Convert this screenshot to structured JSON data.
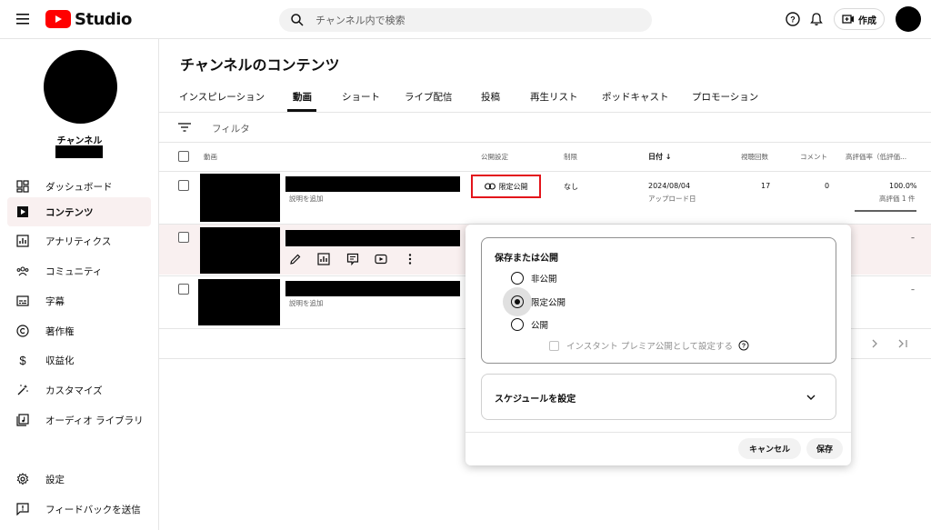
{
  "header": {
    "logo_text": "Studio",
    "search_placeholder": "チャンネル内で検索",
    "create_label": "作成"
  },
  "sidebar": {
    "channel_label": "チャンネル",
    "items": [
      {
        "label": "ダッシュボード",
        "icon": "dashboard-icon"
      },
      {
        "label": "コンテンツ",
        "icon": "content-icon",
        "active": true
      },
      {
        "label": "アナリティクス",
        "icon": "analytics-icon"
      },
      {
        "label": "コミュニティ",
        "icon": "community-icon"
      },
      {
        "label": "字幕",
        "icon": "subtitles-icon"
      },
      {
        "label": "著作権",
        "icon": "copyright-icon"
      },
      {
        "label": "収益化",
        "icon": "monetization-icon"
      },
      {
        "label": "カスタマイズ",
        "icon": "customize-icon"
      },
      {
        "label": "オーディオ ライブラリ",
        "icon": "audio-library-icon"
      }
    ],
    "bottom_items": [
      {
        "label": "設定",
        "icon": "settings-icon"
      },
      {
        "label": "フィードバックを送信",
        "icon": "feedback-icon"
      }
    ]
  },
  "main": {
    "title": "チャンネルのコンテンツ",
    "tabs": [
      "インスピレーション",
      "動画",
      "ショート",
      "ライブ配信",
      "投稿",
      "再生リスト",
      "ポッドキャスト",
      "プロモーション"
    ],
    "active_tab": "動画",
    "filter_label": "フィルタ",
    "columns": {
      "video": "動画",
      "visibility": "公開設定",
      "restrictions": "制限",
      "date": "日付",
      "date_sort": "↓",
      "views": "視聴回数",
      "comments": "コメント",
      "ratio": "高評価率（低評価..."
    },
    "rows": [
      {
        "description": "説明を追加",
        "visibility": "限定公開",
        "restrictions": "なし",
        "date": "2024/08/04",
        "date_sub": "アップロード日",
        "views": "17",
        "comments": "0",
        "ratio": "100.0%",
        "ratio_sub": "高評価 1 件",
        "ratio_value": 1.0
      },
      {
        "ratio": "–"
      },
      {
        "description": "説明を追加",
        "ratio": "–"
      }
    ]
  },
  "popup": {
    "section_title": "保存または公開",
    "options": [
      "非公開",
      "限定公開",
      "公開"
    ],
    "selected": "限定公開",
    "premiere_label": "インスタント プレミア公開として設定する",
    "schedule_label": "スケジュールを設定",
    "cancel_label": "キャンセル",
    "save_label": "保存"
  },
  "colors": {
    "brand_red": "#ff0000",
    "highlight_red": "#e3141b",
    "active_nav_bg": "#f9f0f0"
  }
}
